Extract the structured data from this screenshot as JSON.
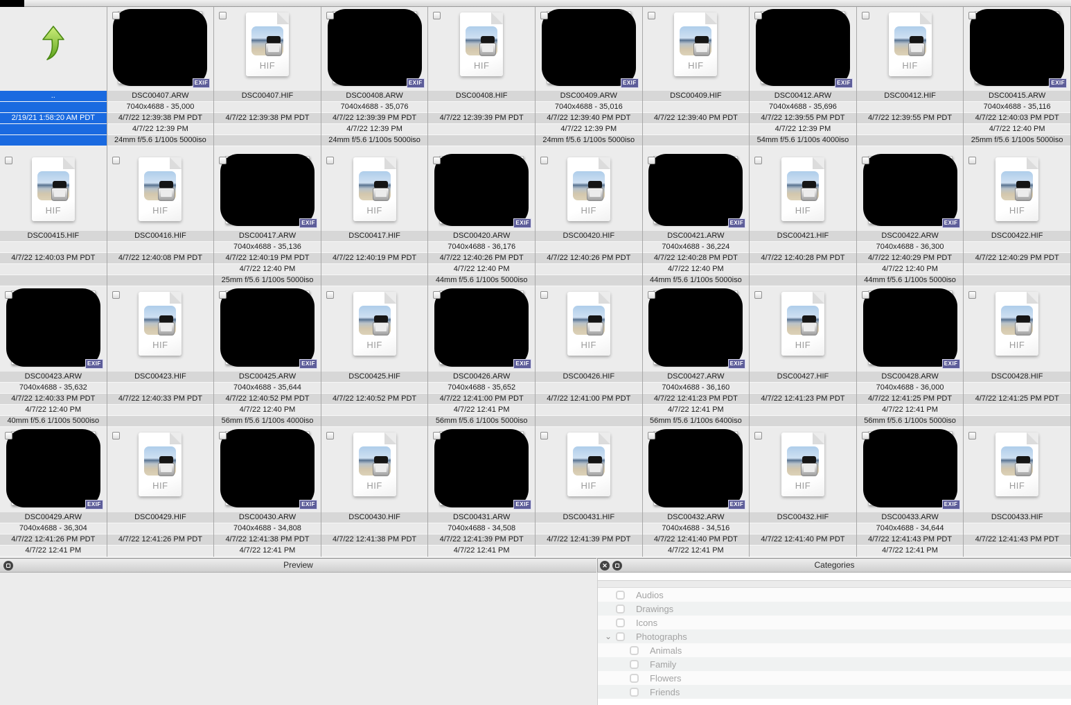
{
  "colors": {
    "selection": "#1a6ae0",
    "exif_badge": "#5d5d99"
  },
  "labels": {
    "hif_ext": "HIF",
    "exif_badge": "EXIF"
  },
  "grid": {
    "rows": [
      {
        "id": "r1",
        "meta_rows": 5,
        "cells": [
          {
            "kind": "parent",
            "label": "..",
            "date": "2/19/21 1:58:20 AM PDT"
          },
          {
            "kind": "arw",
            "name": "DSC00407.ARW",
            "resolution": "7040x4688 - 35,000",
            "modified": "4/7/22 12:39:38 PM PDT",
            "taken": "4/7/22 12:39 PM",
            "exif": "24mm f/5.6 1/100s 5000iso"
          },
          {
            "kind": "hif",
            "name": "DSC00407.HIF",
            "modified": "4/7/22 12:39:38 PM PDT"
          },
          {
            "kind": "arw",
            "name": "DSC00408.ARW",
            "resolution": "7040x4688 - 35,076",
            "modified": "4/7/22 12:39:39 PM PDT",
            "taken": "4/7/22 12:39 PM",
            "exif": "24mm f/5.6 1/100s 5000iso"
          },
          {
            "kind": "hif",
            "name": "DSC00408.HIF",
            "modified": "4/7/22 12:39:39 PM PDT"
          },
          {
            "kind": "arw",
            "name": "DSC00409.ARW",
            "resolution": "7040x4688 - 35,016",
            "modified": "4/7/22 12:39:40 PM PDT",
            "taken": "4/7/22 12:39 PM",
            "exif": "24mm f/5.6 1/100s 5000iso"
          },
          {
            "kind": "hif",
            "name": "DSC00409.HIF",
            "modified": "4/7/22 12:39:40 PM PDT"
          },
          {
            "kind": "arw",
            "name": "DSC00412.ARW",
            "resolution": "7040x4688 - 35,696",
            "modified": "4/7/22 12:39:55 PM PDT",
            "taken": "4/7/22 12:39 PM",
            "exif": "54mm f/5.6 1/100s 4000iso"
          },
          {
            "kind": "hif",
            "name": "DSC00412.HIF",
            "modified": "4/7/22 12:39:55 PM PDT"
          },
          {
            "kind": "arw",
            "name": "DSC00415.ARW",
            "resolution": "7040x4688 - 35,116",
            "modified": "4/7/22 12:40:03 PM PDT",
            "taken": "4/7/22 12:40 PM",
            "exif": "25mm f/5.6 1/100s 5000iso"
          }
        ]
      },
      {
        "id": "r2",
        "meta_rows": 5,
        "cells": [
          {
            "kind": "hif",
            "name": "DSC00415.HIF",
            "modified": "4/7/22 12:40:03 PM PDT"
          },
          {
            "kind": "hif",
            "name": "DSC00416.HIF",
            "modified": "4/7/22 12:40:08 PM PDT"
          },
          {
            "kind": "arw",
            "name": "DSC00417.ARW",
            "resolution": "7040x4688 - 35,136",
            "modified": "4/7/22 12:40:19 PM PDT",
            "taken": "4/7/22 12:40 PM",
            "exif": "25mm f/5.6 1/100s 5000iso"
          },
          {
            "kind": "hif",
            "name": "DSC00417.HIF",
            "modified": "4/7/22 12:40:19 PM PDT"
          },
          {
            "kind": "arw",
            "name": "DSC00420.ARW",
            "resolution": "7040x4688 - 36,176",
            "modified": "4/7/22 12:40:26 PM PDT",
            "taken": "4/7/22 12:40 PM",
            "exif": "44mm f/5.6 1/100s 5000iso"
          },
          {
            "kind": "hif",
            "name": "DSC00420.HIF",
            "modified": "4/7/22 12:40:26 PM PDT"
          },
          {
            "kind": "arw",
            "name": "DSC00421.ARW",
            "resolution": "7040x4688 - 36,224",
            "modified": "4/7/22 12:40:28 PM PDT",
            "taken": "4/7/22 12:40 PM",
            "exif": "44mm f/5.6 1/100s 5000iso"
          },
          {
            "kind": "hif",
            "name": "DSC00421.HIF",
            "modified": "4/7/22 12:40:28 PM PDT"
          },
          {
            "kind": "arw",
            "name": "DSC00422.ARW",
            "resolution": "7040x4688 - 36,300",
            "modified": "4/7/22 12:40:29 PM PDT",
            "taken": "4/7/22 12:40 PM",
            "exif": "44mm f/5.6 1/100s 5000iso"
          },
          {
            "kind": "hif",
            "name": "DSC00422.HIF",
            "modified": "4/7/22 12:40:29 PM PDT"
          }
        ]
      },
      {
        "id": "r3",
        "meta_rows": 5,
        "cells": [
          {
            "kind": "arw",
            "name": "DSC00423.ARW",
            "resolution": "7040x4688 - 35,632",
            "modified": "4/7/22 12:40:33 PM PDT",
            "taken": "4/7/22 12:40 PM",
            "exif": "40mm f/5.6 1/100s 5000iso"
          },
          {
            "kind": "hif",
            "name": "DSC00423.HIF",
            "modified": "4/7/22 12:40:33 PM PDT"
          },
          {
            "kind": "arw",
            "name": "DSC00425.ARW",
            "resolution": "7040x4688 - 35,644",
            "modified": "4/7/22 12:40:52 PM PDT",
            "taken": "4/7/22 12:40 PM",
            "exif": "56mm f/5.6 1/100s 4000iso"
          },
          {
            "kind": "hif",
            "name": "DSC00425.HIF",
            "modified": "4/7/22 12:40:52 PM PDT"
          },
          {
            "kind": "arw",
            "name": "DSC00426.ARW",
            "resolution": "7040x4688 - 35,652",
            "modified": "4/7/22 12:41:00 PM PDT",
            "taken": "4/7/22 12:41 PM",
            "exif": "56mm f/5.6 1/100s 5000iso"
          },
          {
            "kind": "hif",
            "name": "DSC00426.HIF",
            "modified": "4/7/22 12:41:00 PM PDT"
          },
          {
            "kind": "arw",
            "name": "DSC00427.ARW",
            "resolution": "7040x4688 - 36,160",
            "modified": "4/7/22 12:41:23 PM PDT",
            "taken": "4/7/22 12:41 PM",
            "exif": "56mm f/5.6 1/100s 6400iso"
          },
          {
            "kind": "hif",
            "name": "DSC00427.HIF",
            "modified": "4/7/22 12:41:23 PM PDT"
          },
          {
            "kind": "arw",
            "name": "DSC00428.ARW",
            "resolution": "7040x4688 - 36,000",
            "modified": "4/7/22 12:41:25 PM PDT",
            "taken": "4/7/22 12:41 PM",
            "exif": "56mm f/5.6 1/100s 5000iso"
          },
          {
            "kind": "hif",
            "name": "DSC00428.HIF",
            "modified": "4/7/22 12:41:25 PM PDT"
          }
        ]
      },
      {
        "id": "r4",
        "meta_rows": 4,
        "cells": [
          {
            "kind": "arw",
            "name": "DSC00429.ARW",
            "resolution": "7040x4688 - 36,304",
            "modified": "4/7/22 12:41:26 PM PDT",
            "taken": "4/7/22 12:41 PM"
          },
          {
            "kind": "hif",
            "name": "DSC00429.HIF",
            "modified": "4/7/22 12:41:26 PM PDT"
          },
          {
            "kind": "arw",
            "name": "DSC00430.ARW",
            "resolution": "7040x4688 - 34,808",
            "modified": "4/7/22 12:41:38 PM PDT",
            "taken": "4/7/22 12:41 PM"
          },
          {
            "kind": "hif",
            "name": "DSC00430.HIF",
            "modified": "4/7/22 12:41:38 PM PDT"
          },
          {
            "kind": "arw",
            "name": "DSC00431.ARW",
            "resolution": "7040x4688 - 34,508",
            "modified": "4/7/22 12:41:39 PM PDT",
            "taken": "4/7/22 12:41 PM"
          },
          {
            "kind": "hif",
            "name": "DSC00431.HIF",
            "modified": "4/7/22 12:41:39 PM PDT"
          },
          {
            "kind": "arw",
            "name": "DSC00432.ARW",
            "resolution": "7040x4688 - 34,516",
            "modified": "4/7/22 12:41:40 PM PDT",
            "taken": "4/7/22 12:41 PM"
          },
          {
            "kind": "hif",
            "name": "DSC00432.HIF",
            "modified": "4/7/22 12:41:40 PM PDT"
          },
          {
            "kind": "arw",
            "name": "DSC00433.ARW",
            "resolution": "7040x4688 - 34,644",
            "modified": "4/7/22 12:41:43 PM PDT",
            "taken": "4/7/22 12:41 PM"
          },
          {
            "kind": "hif",
            "name": "DSC00433.HIF",
            "modified": "4/7/22 12:41:43 PM PDT"
          }
        ]
      }
    ]
  },
  "preview_panel": {
    "title": "Preview"
  },
  "categories_panel": {
    "title": "Categories",
    "items": [
      {
        "label": "Audios",
        "level": 1,
        "expanded": false,
        "checked": false
      },
      {
        "label": "Drawings",
        "level": 1,
        "expanded": false,
        "checked": false
      },
      {
        "label": "Icons",
        "level": 1,
        "expanded": false,
        "checked": false
      },
      {
        "label": "Photographs",
        "level": 1,
        "expanded": true,
        "checked": false
      },
      {
        "label": "Animals",
        "level": 2,
        "expanded": false,
        "checked": false
      },
      {
        "label": "Family",
        "level": 2,
        "expanded": false,
        "checked": false
      },
      {
        "label": "Flowers",
        "level": 2,
        "expanded": false,
        "checked": false
      },
      {
        "label": "Friends",
        "level": 2,
        "expanded": false,
        "checked": false
      }
    ]
  }
}
